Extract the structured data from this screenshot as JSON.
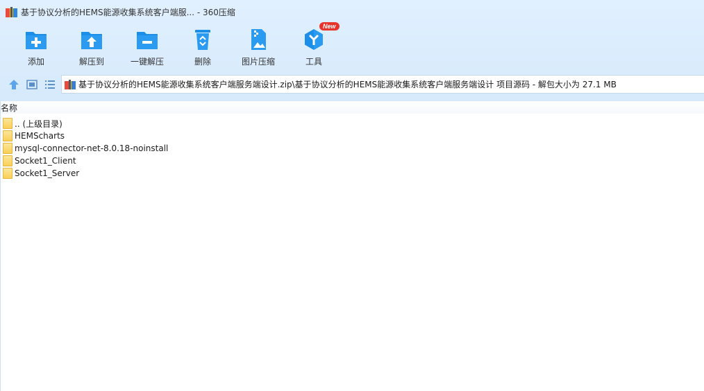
{
  "window": {
    "title": "基于协议分析的HEMS能源收集系统客户端服... - 360压缩",
    "icon": "archive-icon"
  },
  "toolbar": {
    "items": [
      {
        "label": "添加",
        "icon": "folder-add-icon"
      },
      {
        "label": "解压到",
        "icon": "folder-extract-icon"
      },
      {
        "label": "一键解压",
        "icon": "folder-oneclick-extract-icon"
      },
      {
        "label": "删除",
        "icon": "recycle-bin-icon"
      },
      {
        "label": "图片压缩",
        "icon": "image-compress-icon"
      },
      {
        "label": "工具",
        "icon": "tools-icon",
        "badge": "New"
      }
    ]
  },
  "nav": {
    "up_icon": "up-arrow-icon",
    "thumbnail_icon": "thumbnail-view-icon",
    "list_icon": "list-view-icon"
  },
  "address": {
    "path": "基于协议分析的HEMS能源收集系统客户端服务端设计.zip\\基于协议分析的HEMS能源收集系统客户端服务端设计 项目源码 - 解包大小为 27.1 MB"
  },
  "list": {
    "column_name": "名称",
    "items": [
      {
        "name": ".. (上级目录)",
        "icon": "folder-icon"
      },
      {
        "name": "HEMScharts",
        "icon": "folder-icon"
      },
      {
        "name": "mysql-connector-net-8.0.18-noinstall",
        "icon": "folder-icon"
      },
      {
        "name": "Socket1_Client",
        "icon": "folder-icon"
      },
      {
        "name": "Socket1_Server",
        "icon": "folder-icon"
      }
    ]
  },
  "colors": {
    "accent": "#1b8ee8",
    "chrome_bg": "#dcedfd",
    "folder": "#f8cf58",
    "badge": "#e8332d"
  }
}
